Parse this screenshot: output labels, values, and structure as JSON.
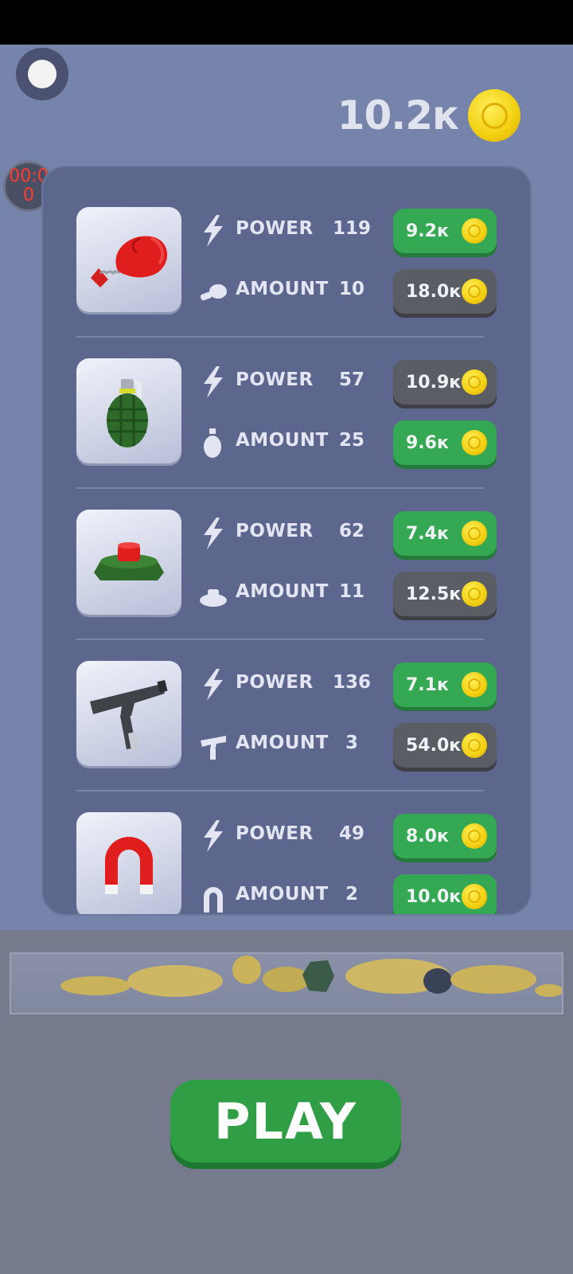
{
  "header": {
    "coin_balance": "10.2к"
  },
  "timer": {
    "text": "00:00"
  },
  "upgrades": [
    {
      "item": "boxing-glove",
      "power": {
        "label": "POWER",
        "value": "119",
        "price": "9.2к",
        "affordable": true
      },
      "amount": {
        "label": "AMOUNT",
        "value": "10",
        "price": "18.0к",
        "affordable": false
      }
    },
    {
      "item": "grenade",
      "power": {
        "label": "POWER",
        "value": "57",
        "price": "10.9к",
        "affordable": false
      },
      "amount": {
        "label": "AMOUNT",
        "value": "25",
        "price": "9.6к",
        "affordable": true
      }
    },
    {
      "item": "landmine",
      "power": {
        "label": "POWER",
        "value": "62",
        "price": "7.4к",
        "affordable": true
      },
      "amount": {
        "label": "AMOUNT",
        "value": "11",
        "price": "12.5к",
        "affordable": false
      }
    },
    {
      "item": "uzi",
      "power": {
        "label": "POWER",
        "value": "136",
        "price": "7.1к",
        "affordable": true
      },
      "amount": {
        "label": "AMOUNT",
        "value": "3",
        "price": "54.0к",
        "affordable": false
      }
    },
    {
      "item": "magnet",
      "power": {
        "label": "POWER",
        "value": "49",
        "price": "8.0к",
        "affordable": true
      },
      "amount": {
        "label": "AMOUNT",
        "value": "2",
        "price": "10.0к",
        "affordable": true
      }
    }
  ],
  "play_button": {
    "label": "PLAY"
  },
  "colors": {
    "affordable_button": "#34a853",
    "locked_button": "#5a5d64",
    "coin": "#f2cf10",
    "timer_text": "#ff3b30"
  }
}
